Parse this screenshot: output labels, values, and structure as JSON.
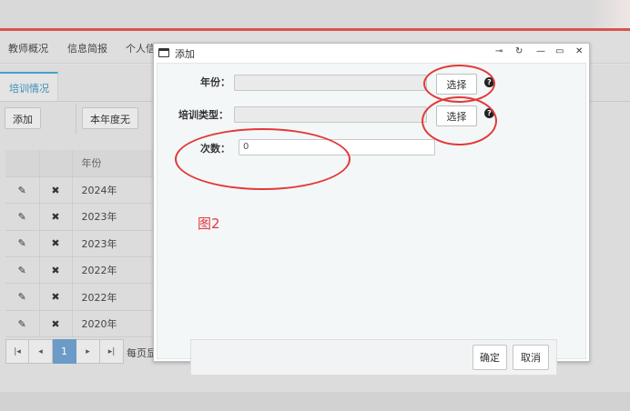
{
  "nav": {
    "items": [
      "教师概况",
      "信息简报",
      "个人信"
    ]
  },
  "subtab": {
    "label": "培训情况"
  },
  "toolbar": {
    "add_label": "添加",
    "filter_label": "本年度无"
  },
  "table": {
    "header": "年份",
    "rows": [
      "2024年",
      "2023年",
      "2023年",
      "2022年",
      "2022年",
      "2020年"
    ],
    "edit_glyph": "✎",
    "delete_glyph": "✖"
  },
  "pager": {
    "first": "|◂",
    "prev": "◂",
    "current": "1",
    "next": "▸",
    "last": "▸|",
    "size_label": "每页显"
  },
  "dialog": {
    "title": "添加",
    "controls": {
      "pin": "⊸",
      "refresh": "↻",
      "minimize": "—",
      "maximize": "▭",
      "close": "✕"
    },
    "year_label": "年份：",
    "year_select": "选择",
    "type_label": "培训类型：",
    "type_select": "选择",
    "count_label": "次数：",
    "count_value": "0",
    "help": "?",
    "ok": "确定",
    "cancel": "取消"
  },
  "annotation": {
    "text": "图2",
    "color": "#e23a3a"
  },
  "colors": {
    "accent": "#46a0c8",
    "topline": "#d9534f",
    "pager_active": "#6b9bc6"
  }
}
